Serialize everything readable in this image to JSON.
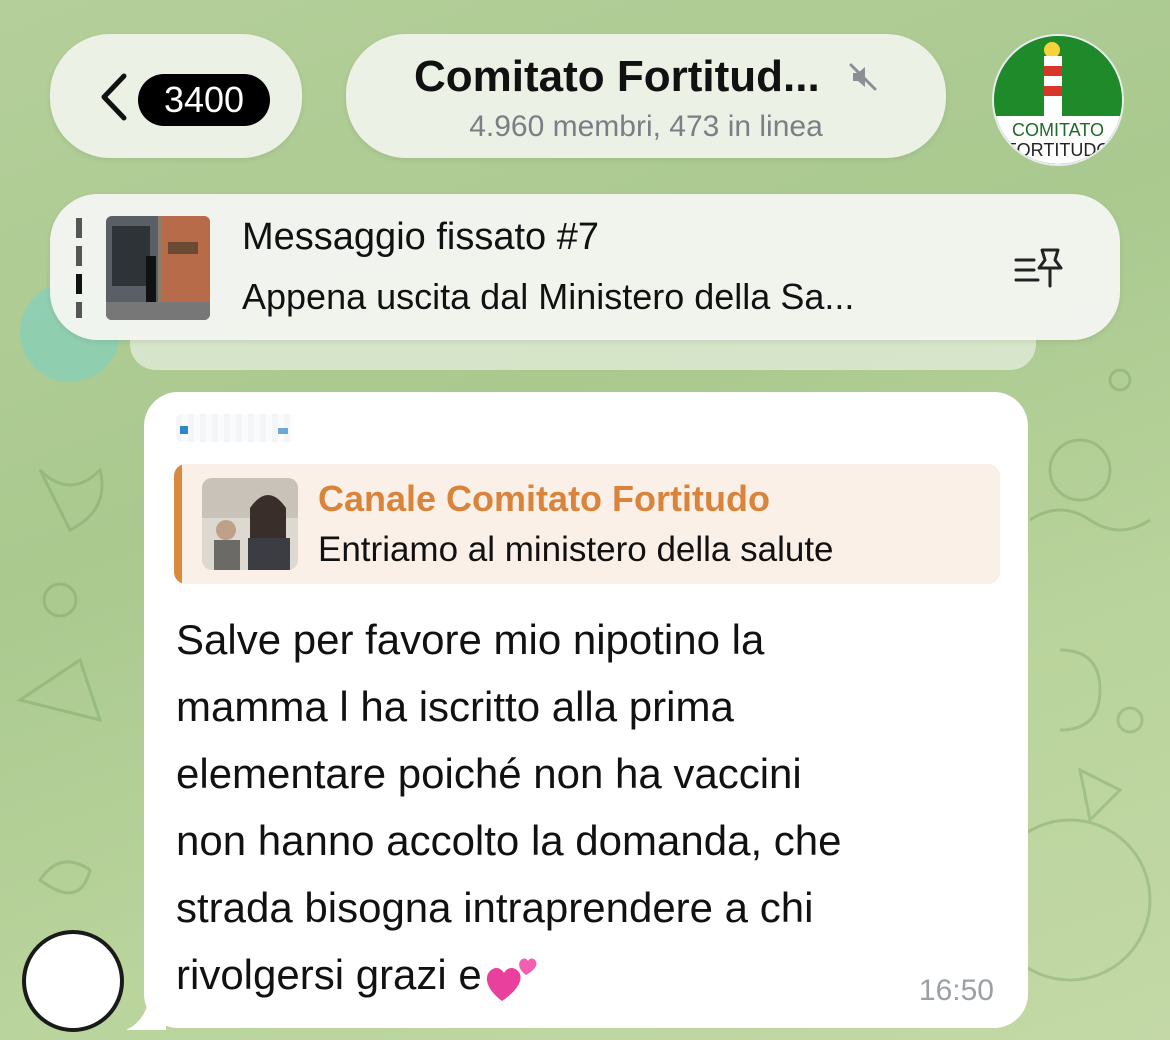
{
  "header": {
    "back_badge": "3400",
    "title": "Comitato Fortitud...",
    "subtitle": "4.960 membri, 473 in linea",
    "avatar_text_line1": "COMITATO",
    "avatar_text_line2": "FORTITUDO"
  },
  "pinned": {
    "title": "Messaggio fissato #7",
    "text": "Appena uscita dal Ministero della Sa..."
  },
  "message": {
    "forward_source": "Canale Comitato Fortitudo",
    "forward_text": "Entriamo al ministero della salute",
    "text": "Salve per favore mio nipotino la\nmamma l ha iscritto alla prima\nelementare poiché non ha vaccini\nnon hanno accolto la domanda, che\nstrada bisogna intraprendere a chi\nrivolgersi grazi e",
    "time": "16:50"
  },
  "colors": {
    "accent_orange": "#d9843a",
    "badge_bg": "#000000",
    "avatar_green": "#1f8a2a"
  },
  "icons": [
    "chevron-left-icon",
    "mute-icon",
    "pin-list-icon",
    "two-hearts-icon"
  ]
}
